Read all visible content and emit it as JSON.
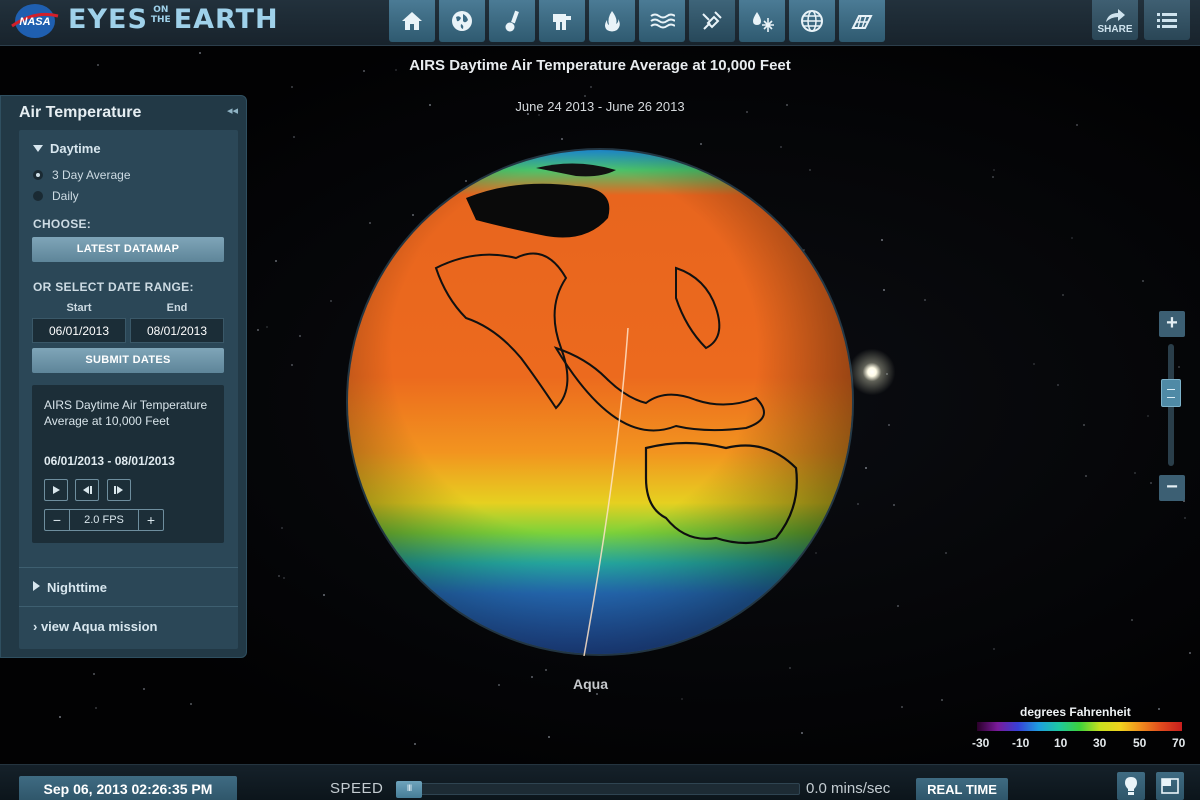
{
  "header": {
    "logo_text": "NASA",
    "brand_main_1": "EYES",
    "brand_small_top": "ON",
    "brand_small_bottom": "THE",
    "brand_main_2": "EARTH",
    "toolbar_icons": [
      "home-icon",
      "globe-icon",
      "thermometer-icon",
      "satellite-dish-icon",
      "flame-icon",
      "sea-waves-icon",
      "satellite-icon",
      "water-ice-icon",
      "grid-globe-icon",
      "solar-panel-icon"
    ],
    "share_label": "SHARE"
  },
  "map": {
    "title": "AIRS Daytime Air Temperature Average at 10,000 Feet",
    "dates": "June 24 2013 - June 26 2013",
    "satellite_label": "Aqua"
  },
  "panel": {
    "title": "Air Temperature",
    "daytime_label": "Daytime",
    "radio_options": [
      "3 Day Average",
      "Daily"
    ],
    "selected_option": "3 Day Average",
    "choose_label": "CHOOSE:",
    "latest_button": "LATEST DATAMAP",
    "range_label": "OR SELECT DATE RANGE:",
    "start_label": "Start",
    "end_label": "End",
    "start_value": "06/01/2013",
    "end_value": "08/01/2013",
    "submit_button": "SUBMIT DATES",
    "info_name": "AIRS Daytime Air Temperature Average at 10,000 Feet",
    "info_dates": "06/01/2013 - 08/01/2013",
    "fps_value": "2.0 FPS",
    "fps_minus": "−",
    "fps_plus": "+",
    "nighttime_label": "Nighttime",
    "aqua_link": "› view Aqua mission"
  },
  "zoom": {
    "in_label": "+",
    "out_label": "−",
    "level": 0.37
  },
  "legend": {
    "title": "degrees Fahrenheit",
    "ticks": [
      "-30",
      "-10",
      "10",
      "30",
      "50",
      "70"
    ]
  },
  "bottom": {
    "time": "Sep 06, 2013 02:26:35 PM",
    "speed_label": "SPEED",
    "speed_value": "0.0 mins/sec",
    "speed_level": 0,
    "realtime_button": "REAL TIME"
  },
  "colors": {
    "accent": "#4b7b95",
    "panel": "#223946",
    "globe_warm": "#e8541c",
    "globe_cold": "#2f6fd0"
  }
}
